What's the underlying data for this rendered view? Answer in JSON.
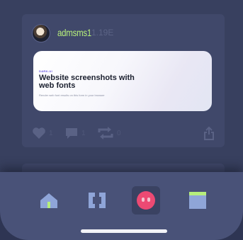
{
  "post": {
    "username": "admsms1",
    "timestamp": "1.19E",
    "link_preview": {
      "kicker": "DARK-UI",
      "title": "Website screenshots with web fonts",
      "subtitle": "Render web font results on this form in your browser"
    },
    "actions": {
      "likes": "1",
      "comments": "1",
      "reposts": "0"
    }
  },
  "tabs": [
    {
      "name": "home",
      "icon": "home-icon",
      "active": false
    },
    {
      "name": "code",
      "icon": "brackets-icon",
      "active": false
    },
    {
      "name": "avatar",
      "icon": "creature-icon",
      "active": true
    },
    {
      "name": "browser",
      "icon": "window-icon",
      "active": false
    }
  ],
  "colors": {
    "accent": "#b6ee7c",
    "background": "#38405f",
    "card": "#40486a",
    "tab_bar": "#495278",
    "highlight": "#ec4a73"
  }
}
